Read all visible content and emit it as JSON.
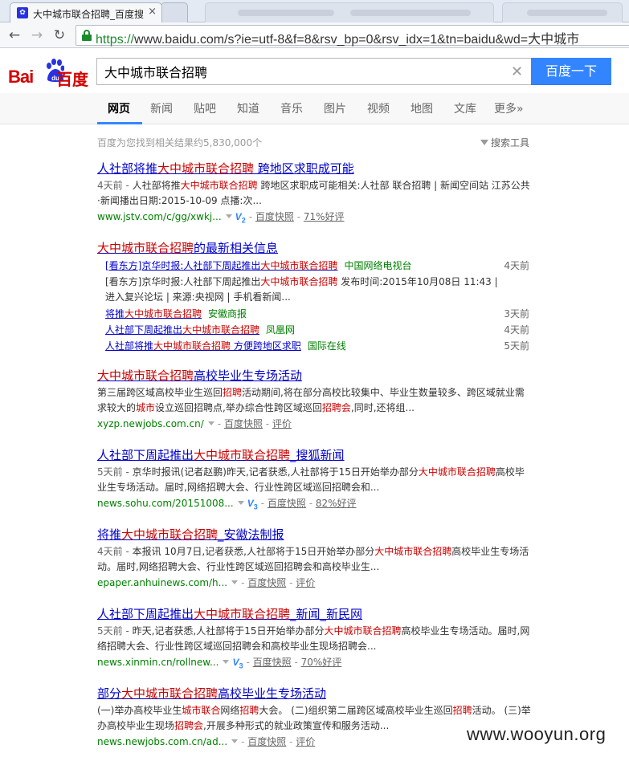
{
  "browser": {
    "active_tab_title": "大中城市联合招聘_百度搜",
    "url_scheme": "https://",
    "url_rest": "www.baidu.com/s?ie=utf-8&f=8&rsv_bp=0&rsv_idx=1&tn=baidu&wd=大中城市"
  },
  "header": {
    "logo_bai": "Bai",
    "logo_du": "du",
    "logo_cn": "百度",
    "search_value": "大中城市联合招聘",
    "search_button": "百度一下"
  },
  "nav_tabs": [
    {
      "label": "网页",
      "active": true
    },
    {
      "label": "新闻"
    },
    {
      "label": "贴吧"
    },
    {
      "label": "知道"
    },
    {
      "label": "音乐"
    },
    {
      "label": "图片"
    },
    {
      "label": "视频"
    },
    {
      "label": "地图"
    },
    {
      "label": "文库"
    },
    {
      "label": "更多»"
    }
  ],
  "result_count": "百度为您找到相关结果约5,830,000个",
  "search_tools": "搜索工具",
  "results": [
    {
      "title": [
        [
          "人社部将推",
          ""
        ],
        [
          "大中城市联合招聘",
          "em"
        ],
        [
          " 跨地区求职成可能",
          ""
        ]
      ],
      "date": "4天前 - ",
      "abstract": [
        [
          "人社部将推",
          ""
        ],
        [
          "大中城市联合招聘",
          "em"
        ],
        [
          " 跨地区求职成可能相关:人社部 联合招聘 | 新闻空间站 江苏公共·新闻播出日期:2015-10-09 点播:次...",
          ""
        ]
      ],
      "url": "www.jstv.com/c/gg/xwkj...",
      "v_level": "2",
      "snapshot": "百度快照",
      "rating": "71%好评"
    },
    {
      "title": [
        [
          "大中城市联合招聘",
          "em"
        ],
        [
          "高校毕业生专场活动",
          ""
        ]
      ],
      "date": "",
      "abstract": [
        [
          "第三届跨区域高校毕业生巡回",
          ""
        ],
        [
          "招聘",
          "em"
        ],
        [
          "活动期间,将在部分高校比较集中、毕业生数量较多、跨区域就业需求较大的",
          ""
        ],
        [
          "城市",
          "em"
        ],
        [
          "设立巡回招聘点,举办综合性跨区域巡回",
          ""
        ],
        [
          "招聘会",
          "em"
        ],
        [
          ",同时,还将组...",
          ""
        ]
      ],
      "url": "xyzp.newjobs.com.cn/",
      "v_level": "",
      "snapshot": "百度快照",
      "rating": "评价"
    },
    {
      "title": [
        [
          "人社部下周起推出",
          ""
        ],
        [
          "大中城市联合招聘",
          "em"
        ],
        [
          "_搜狐新闻",
          ""
        ]
      ],
      "date": "5天前 - ",
      "abstract": [
        [
          "京华时报讯(记者赵鹏)昨天,记者获悉,人社部将于15日开始举办部分",
          ""
        ],
        [
          "大中城市联合招聘",
          "em"
        ],
        [
          "高校毕业生专场活动。届时,网络招聘大会、行业性跨区域巡回招聘会和...",
          ""
        ]
      ],
      "url": "news.sohu.com/20151008...",
      "v_level": "3",
      "snapshot": "百度快照",
      "rating": "82%好评"
    },
    {
      "title": [
        [
          "将推",
          ""
        ],
        [
          "大中城市联合招聘",
          "em"
        ],
        [
          "_安徽法制报",
          ""
        ]
      ],
      "date": "4天前 - ",
      "abstract": [
        [
          "本报讯 10月7日,记者获悉,人社部将于15日开始举办部分",
          ""
        ],
        [
          "大中城市联合招聘",
          "em"
        ],
        [
          "高校毕业生专场活动。届时,网络招聘大会、行业性跨区域巡回招聘会和高校毕业生...",
          ""
        ]
      ],
      "url": "epaper.anhuinews.com/h...",
      "v_level": "",
      "snapshot": "百度快照",
      "rating": "评价"
    },
    {
      "title": [
        [
          "人社部下周起推出",
          ""
        ],
        [
          "大中城市联合招聘",
          "em"
        ],
        [
          "_新闻_新民网",
          ""
        ]
      ],
      "date": "5天前 - ",
      "abstract": [
        [
          "昨天,记者获悉,人社部将于15日开始举办部分",
          ""
        ],
        [
          "大中城市联合招聘",
          "em"
        ],
        [
          "高校毕业生专场活动。届时,网络招聘大会、行业性跨区域巡回招聘会和高校毕业生现场招聘会...",
          ""
        ]
      ],
      "url": "news.xinmin.cn/rollnew...",
      "v_level": "3",
      "snapshot": "百度快照",
      "rating": "70%好评"
    },
    {
      "title": [
        [
          "部分",
          ""
        ],
        [
          "大中城市联合招聘",
          "em"
        ],
        [
          "高校毕业生专场活动",
          ""
        ]
      ],
      "date": "",
      "abstract": [
        [
          "(一)举办高校毕业生",
          ""
        ],
        [
          "城市联合",
          "em"
        ],
        [
          "网络",
          ""
        ],
        [
          "招聘",
          "em"
        ],
        [
          "大会。 (二)组织第二届跨区域高校毕业生巡回",
          ""
        ],
        [
          "招聘",
          "em"
        ],
        [
          "活动。 (三)举办高校毕业生现场",
          ""
        ],
        [
          "招聘会",
          "em"
        ],
        [
          ",开展多种形式的就业政策宣传和服务活动...",
          ""
        ]
      ],
      "url": "news.newjobs.com.cn/ad...",
      "v_level": "",
      "snapshot": "百度快照",
      "rating": "评价"
    }
  ],
  "news_block": {
    "title": [
      [
        "大中城市联合招聘",
        "em"
      ],
      [
        "的最新相关信息",
        ""
      ]
    ],
    "first": {
      "link": [
        [
          "[看东方]京华时报:人社部下周起推出",
          ""
        ],
        [
          "大中城市联合招聘",
          "em"
        ]
      ],
      "source": "中国网络电视台",
      "time": "4天前"
    },
    "abstract": [
      [
        "[看东方]京华时报:人社部下周起推出",
        ""
      ],
      [
        "大中城市联合招聘",
        "em"
      ],
      [
        " 发布时间:2015年10月08日 11:43 | 进入复兴论坛 | 来源:央视网 | 手机看新闻...",
        ""
      ]
    ],
    "items": [
      {
        "link": [
          [
            "将推",
            ""
          ],
          [
            "大中城市联合招聘",
            "em"
          ]
        ],
        "source": "安徽商报",
        "time": "3天前"
      },
      {
        "link": [
          [
            "人社部下周起推出",
            ""
          ],
          [
            "大中城市联合招聘",
            "em"
          ]
        ],
        "source": "凤凰网",
        "time": "4天前"
      },
      {
        "link": [
          [
            "人社部将推",
            ""
          ],
          [
            "大中城市联合招聘",
            "em"
          ],
          [
            " 方便跨地区求职",
            ""
          ]
        ],
        "source": "国际在线",
        "time": "5天前"
      }
    ]
  },
  "watermark": "www.wooyun.org"
}
